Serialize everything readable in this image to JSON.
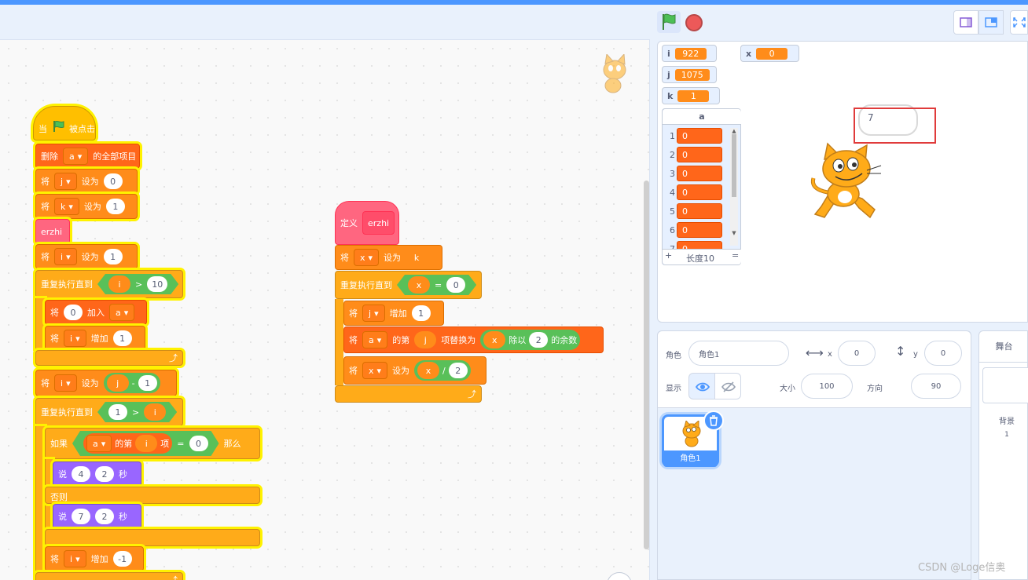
{
  "workspace": {
    "hat": {
      "when": "当",
      "clicked": "被点击"
    },
    "script1": {
      "delete_all": {
        "pre": "删除",
        "list": "a",
        "post": "的全部项目"
      },
      "set_j": {
        "pre": "将",
        "var": "j",
        "mid": "设为",
        "val": "0"
      },
      "set_k": {
        "pre": "将",
        "var": "k",
        "mid": "设为",
        "val": "1"
      },
      "call": "erzhi",
      "set_i": {
        "pre": "将",
        "var": "i",
        "mid": "设为",
        "val": "1"
      },
      "repeat1": {
        "label": "重复执行直到",
        "var": "i",
        "op": ">",
        "val": "10"
      },
      "add": {
        "pre": "将",
        "val": "0",
        "mid": "加入",
        "list": "a"
      },
      "inc_i": {
        "pre": "将",
        "var": "i",
        "mid": "增加",
        "val": "1"
      },
      "set_i2": {
        "pre": "将",
        "var": "i",
        "mid": "设为",
        "a": "j",
        "op": "-",
        "b": "1"
      },
      "repeat2": {
        "label": "重复执行直到",
        "a": "1",
        "op": ">",
        "b": "i"
      },
      "if": {
        "label": "如果",
        "list": "a",
        "of": "的第",
        "idx": "i",
        "item": "项",
        "eq": "=",
        "val": "0",
        "then": "那么"
      },
      "say1": {
        "label": "说",
        "text": "4",
        "secs": "2",
        "unit": "秒"
      },
      "else": "否则",
      "say2": {
        "label": "说",
        "text": "7",
        "secs": "2",
        "unit": "秒"
      },
      "dec_i": {
        "pre": "将",
        "var": "i",
        "mid": "增加",
        "val": "-1"
      }
    },
    "script2": {
      "define": {
        "label": "定义",
        "name": "erzhi"
      },
      "set_x": {
        "pre": "将",
        "var": "x",
        "mid": "设为",
        "val": "k"
      },
      "repeat": {
        "label": "重复执行直到",
        "var": "x",
        "op": "=",
        "val": "0"
      },
      "inc_j": {
        "pre": "将",
        "var": "j",
        "mid": "增加",
        "val": "1"
      },
      "replace": {
        "pre": "将",
        "list": "a",
        "of": "的第",
        "idx": "j",
        "mid": "项替换为",
        "a": "x",
        "mod": "除以",
        "b": "2",
        "post": "的余数"
      },
      "set_x2": {
        "pre": "将",
        "var": "x",
        "mid": "设为",
        "a": "x",
        "op": "/",
        "b": "2"
      }
    }
  },
  "monitors": {
    "i": {
      "name": "i",
      "value": "922"
    },
    "x": {
      "name": "x",
      "value": "0"
    },
    "j": {
      "name": "j",
      "value": "1075"
    },
    "k": {
      "name": "k",
      "value": "1"
    }
  },
  "list_monitor": {
    "title": "a",
    "rows": [
      {
        "idx": "1",
        "val": "0"
      },
      {
        "idx": "2",
        "val": "0"
      },
      {
        "idx": "3",
        "val": "0"
      },
      {
        "idx": "4",
        "val": "0"
      },
      {
        "idx": "5",
        "val": "0"
      },
      {
        "idx": "6",
        "val": "0"
      },
      {
        "idx": "7",
        "val": "0"
      }
    ],
    "add": "+",
    "length": "长度10",
    "resize": "="
  },
  "stage": {
    "speech": "7"
  },
  "sprite_info": {
    "sprite_label": "角色",
    "sprite_name": "角色1",
    "x_label": "x",
    "x": "0",
    "y_label": "y",
    "y": "0",
    "show_label": "显示",
    "size_label": "大小",
    "size": "100",
    "direction_label": "方向",
    "direction": "90"
  },
  "sprite_tile": {
    "name": "角色1"
  },
  "stage_panel": {
    "title": "舞台",
    "backdrops_label": "背景",
    "backdrops_count": "1"
  },
  "watermark": "CSDN @Loge信奥",
  "colors": {
    "accent": "#4c97ff",
    "events": "#ffbf00",
    "control": "#ffab19",
    "variables": "#ff8c1a",
    "lists": "#ff661a",
    "operators": "#59c059",
    "looks": "#9966ff",
    "myblocks": "#ff6680"
  }
}
